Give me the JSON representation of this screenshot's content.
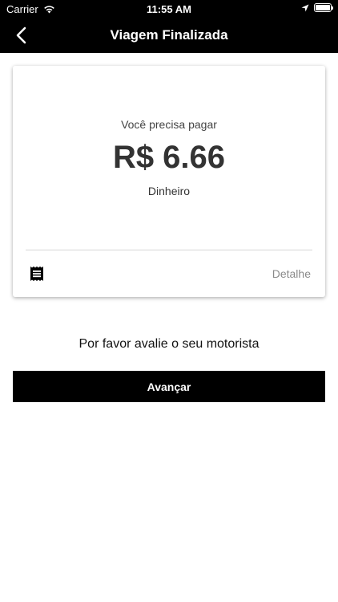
{
  "status_bar": {
    "carrier": "Carrier",
    "time": "11:55 AM",
    "icons": [
      "wifi-icon",
      "location-arrow-icon",
      "battery-icon"
    ]
  },
  "nav": {
    "title": "Viagem Finalizada",
    "back_icon": "chevron-left-icon"
  },
  "payment_card": {
    "label": "Você precisa pagar",
    "amount": "R$ 6.66",
    "method": "Dinheiro",
    "receipt_icon": "receipt-icon",
    "detail_label": "Detalhe"
  },
  "rating": {
    "prompt": "Por favor avalie o seu motorista"
  },
  "actions": {
    "next_label": "Avançar"
  },
  "colors": {
    "bar_background": "#000000",
    "page_background": "#ffffff",
    "detail_text": "#8a8a8a"
  }
}
